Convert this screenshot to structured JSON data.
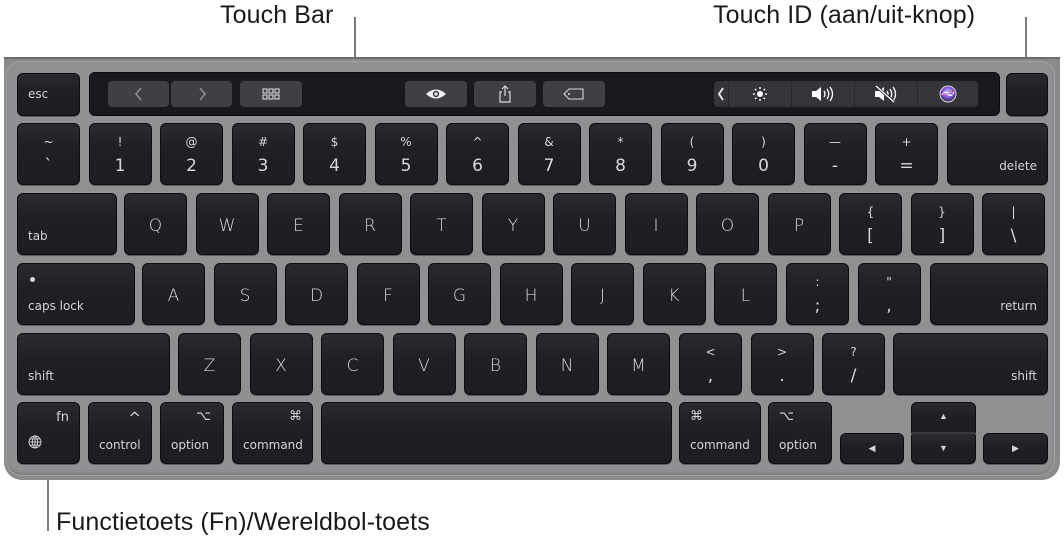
{
  "callouts": {
    "touch_bar": "Touch Bar",
    "touch_id": "Touch ID (aan/uit-knop)",
    "fn_globe": "Functietoets (Fn)/Wereldbol-toets"
  },
  "touch_bar": {
    "esc": "esc",
    "buttons": [
      {
        "icon": "chevron-left-icon",
        "glyph": "‹"
      },
      {
        "icon": "chevron-right-icon",
        "glyph": "›"
      },
      {
        "icon": "grid-icon",
        "glyph": ""
      },
      {
        "icon": "eye-icon",
        "glyph": ""
      },
      {
        "icon": "share-icon",
        "glyph": ""
      },
      {
        "icon": "tag-icon",
        "glyph": ""
      }
    ],
    "control_strip": [
      {
        "icon": "collapse-chevron-icon",
        "glyph": "‹"
      },
      {
        "icon": "brightness-icon",
        "glyph": "☀"
      },
      {
        "icon": "volume-icon",
        "glyph": "🔊"
      },
      {
        "icon": "mute-icon",
        "glyph": "🔇"
      },
      {
        "icon": "siri-icon",
        "glyph": ""
      }
    ]
  },
  "rows": {
    "numbers": [
      {
        "top": "~",
        "bot": "`"
      },
      {
        "top": "!",
        "bot": "1"
      },
      {
        "top": "@",
        "bot": "2"
      },
      {
        "top": "#",
        "bot": "3"
      },
      {
        "top": "$",
        "bot": "4"
      },
      {
        "top": "%",
        "bot": "5"
      },
      {
        "top": "^",
        "bot": "6"
      },
      {
        "top": "&",
        "bot": "7"
      },
      {
        "top": "*",
        "bot": "8"
      },
      {
        "top": "(",
        "bot": "9"
      },
      {
        "top": ")",
        "bot": "0"
      },
      {
        "top": "—",
        "bot": "-"
      },
      {
        "top": "+",
        "bot": "="
      }
    ],
    "delete": "delete",
    "tab": "tab",
    "qwerty": [
      "Q",
      "W",
      "E",
      "R",
      "T",
      "Y",
      "U",
      "I",
      "O",
      "P"
    ],
    "brackets": [
      {
        "top": "{",
        "bot": "["
      },
      {
        "top": "}",
        "bot": "]"
      },
      {
        "top": "|",
        "bot": "\\"
      }
    ],
    "caps_lock": "caps lock",
    "asdf": [
      "A",
      "S",
      "D",
      "F",
      "G",
      "H",
      "J",
      "K",
      "L"
    ],
    "semi": [
      {
        "top": ":",
        "bot": ";"
      },
      {
        "top": "\"",
        "bot": ","
      }
    ],
    "return": "return",
    "shift_left": "shift",
    "zxcv": [
      "Z",
      "X",
      "C",
      "V",
      "B",
      "N",
      "M"
    ],
    "punct": [
      {
        "top": "<",
        "bot": ","
      },
      {
        "top": ">",
        "bot": "."
      },
      {
        "top": "?",
        "bot": "/"
      }
    ],
    "shift_right": "shift",
    "bottom": {
      "fn": "fn",
      "control": "control",
      "control_sym": "^",
      "option": "option",
      "option_sym": "⌥",
      "command": "command",
      "command_sym": "⌘",
      "command_r": "command",
      "command_r_sym": "⌘",
      "option_r": "option",
      "option_r_sym": "⌥",
      "arrow_left": "◀",
      "arrow_up": "▲",
      "arrow_down": "▼",
      "arrow_right": "▶"
    }
  }
}
